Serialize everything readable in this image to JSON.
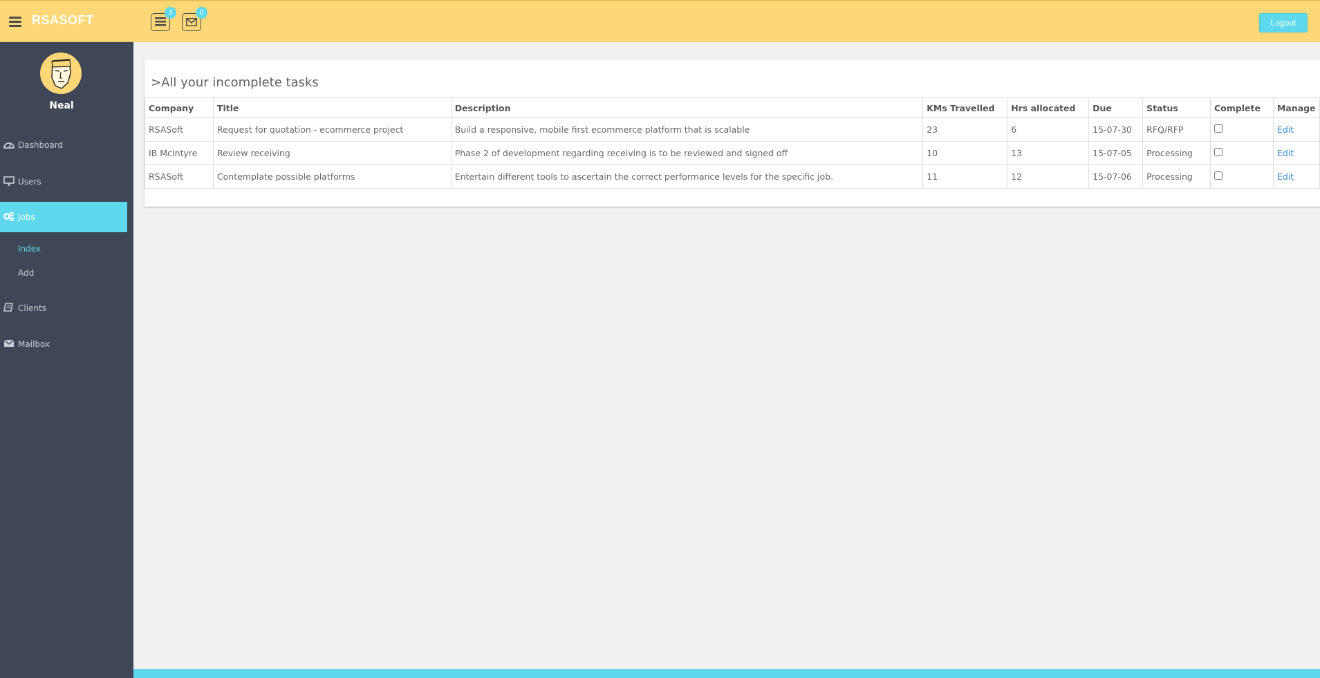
{
  "header": {
    "brand": "RSASOFT",
    "tasks_badge": "3",
    "mail_badge": "0",
    "logout_label": "Logout"
  },
  "sidebar": {
    "username": "Neal",
    "items": [
      {
        "label": "Dashboard",
        "icon": "dashboard-icon"
      },
      {
        "label": "Users",
        "icon": "desktop-icon"
      },
      {
        "label": "Jobs",
        "icon": "gears-icon",
        "active": true
      },
      {
        "label": "Clients",
        "icon": "book-icon"
      },
      {
        "label": "Mailbox",
        "icon": "envelope-icon"
      }
    ],
    "jobs_sub": [
      {
        "label": "Index",
        "current": true
      },
      {
        "label": "Add"
      }
    ]
  },
  "main": {
    "panel_title": ">All your incomplete tasks",
    "columns": [
      "Company",
      "Title",
      "Description",
      "KMs Travelled",
      "Hrs allocated",
      "Due",
      "Status",
      "Complete",
      "Manage"
    ],
    "rows": [
      {
        "company": "RSASoft",
        "title": "Request for quotation - ecommerce project",
        "description": "Build a responsive, mobile first ecommerce platform that is scalable",
        "kms": "23",
        "hrs": "6",
        "due": "15-07-30",
        "status": "RFQ/RFP",
        "complete": false,
        "manage": "Edit"
      },
      {
        "company": "IB McIntyre",
        "title": "Review receiving",
        "description": "Phase 2 of development regarding receiving is to be reviewed and signed off",
        "kms": "10",
        "hrs": "13",
        "due": "15-07-05",
        "status": "Processing",
        "complete": false,
        "manage": "Edit"
      },
      {
        "company": "RSASoft",
        "title": "Contemplate possible platforms",
        "description": "Entertain different tools to ascertain the correct performance levels for the specific job.",
        "kms": "11",
        "hrs": "12",
        "due": "15-07-06",
        "status": "Processing",
        "complete": false,
        "manage": "Edit"
      }
    ]
  },
  "colors": {
    "header_bg": "#fed776",
    "sidebar_bg": "#3f4756",
    "accent": "#5fd8ee",
    "link": "#3a8ad6"
  }
}
